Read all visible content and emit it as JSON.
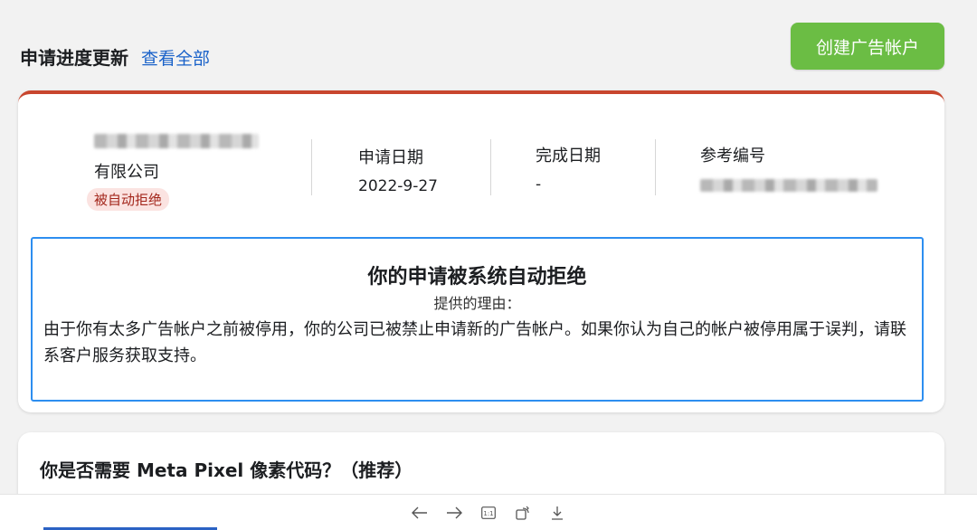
{
  "header": {
    "title": "申请进度更新",
    "view_all": "查看全部",
    "create_button": "创建广告帐户"
  },
  "application": {
    "company_suffix": "有限公司",
    "status": "被自动拒绝",
    "apply_date_label": "申请日期",
    "apply_date_value": "2022-9-27",
    "complete_date_label": "完成日期",
    "complete_date_value": "-",
    "reference_label": "参考编号"
  },
  "notice": {
    "title": "你的申请被系统自动拒绝",
    "subtitle": "提供的理由：",
    "body": "由于你有太多广告帐户之前被停用，你的公司已被禁止申请新的广告帐户。如果你认为自己的帐户被停用属于误判，请联系客户服务获取支持。"
  },
  "pixel_card": {
    "title": "你是否需要 Meta Pixel 像素代码？（推荐）"
  },
  "viewer": {
    "icons": [
      "arrow-left-icon",
      "arrow-right-icon",
      "actual-size-icon",
      "rotate-icon",
      "download-icon"
    ]
  },
  "colors": {
    "accent_green": "#6bbd44",
    "link_blue": "#1a62c9",
    "rejected_red": "#c8462e",
    "notice_border": "#2d8ef0"
  }
}
